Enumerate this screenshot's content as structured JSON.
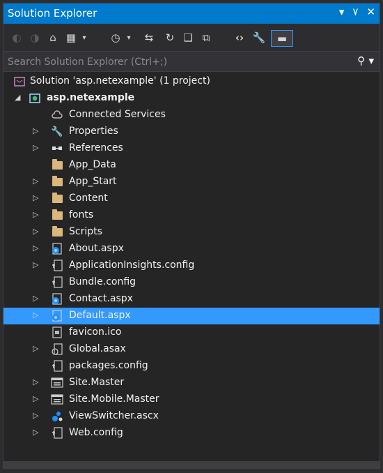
{
  "window": {
    "title": "Solution Explorer"
  },
  "search": {
    "placeholder": "Search Solution Explorer (Ctrl+;)"
  },
  "tree": {
    "solution": "Solution 'asp.netexample' (1 project)",
    "project": "asp.netexample",
    "items": [
      {
        "label": "Connected Services",
        "icon": "cloud-icon",
        "expandable": false
      },
      {
        "label": "Properties",
        "icon": "wrench-icon",
        "expandable": true
      },
      {
        "label": "References",
        "icon": "references-icon",
        "expandable": true
      },
      {
        "label": "App_Data",
        "icon": "folder-icon",
        "expandable": false
      },
      {
        "label": "App_Start",
        "icon": "folder-icon",
        "expandable": true
      },
      {
        "label": "Content",
        "icon": "folder-icon",
        "expandable": true
      },
      {
        "label": "fonts",
        "icon": "folder-icon",
        "expandable": true
      },
      {
        "label": "Scripts",
        "icon": "folder-icon",
        "expandable": true
      },
      {
        "label": "About.aspx",
        "icon": "web-page-icon",
        "expandable": true
      },
      {
        "label": "ApplicationInsights.config",
        "icon": "config-icon",
        "expandable": true
      },
      {
        "label": "Bundle.config",
        "icon": "config-icon",
        "expandable": false
      },
      {
        "label": "Contact.aspx",
        "icon": "web-page-icon",
        "expandable": true
      },
      {
        "label": "Default.aspx",
        "icon": "web-page-icon",
        "expandable": true,
        "selected": true
      },
      {
        "label": "favicon.ico",
        "icon": "image-file-icon",
        "expandable": false
      },
      {
        "label": "Global.asax",
        "icon": "global-icon",
        "expandable": true
      },
      {
        "label": "packages.config",
        "icon": "config-icon",
        "expandable": false
      },
      {
        "label": "Site.Master",
        "icon": "master-page-icon",
        "expandable": true
      },
      {
        "label": "Site.Mobile.Master",
        "icon": "master-page-icon",
        "expandable": true
      },
      {
        "label": "ViewSwitcher.ascx",
        "icon": "user-control-icon",
        "expandable": true
      },
      {
        "label": "Web.config",
        "icon": "config-icon",
        "expandable": true
      }
    ]
  }
}
